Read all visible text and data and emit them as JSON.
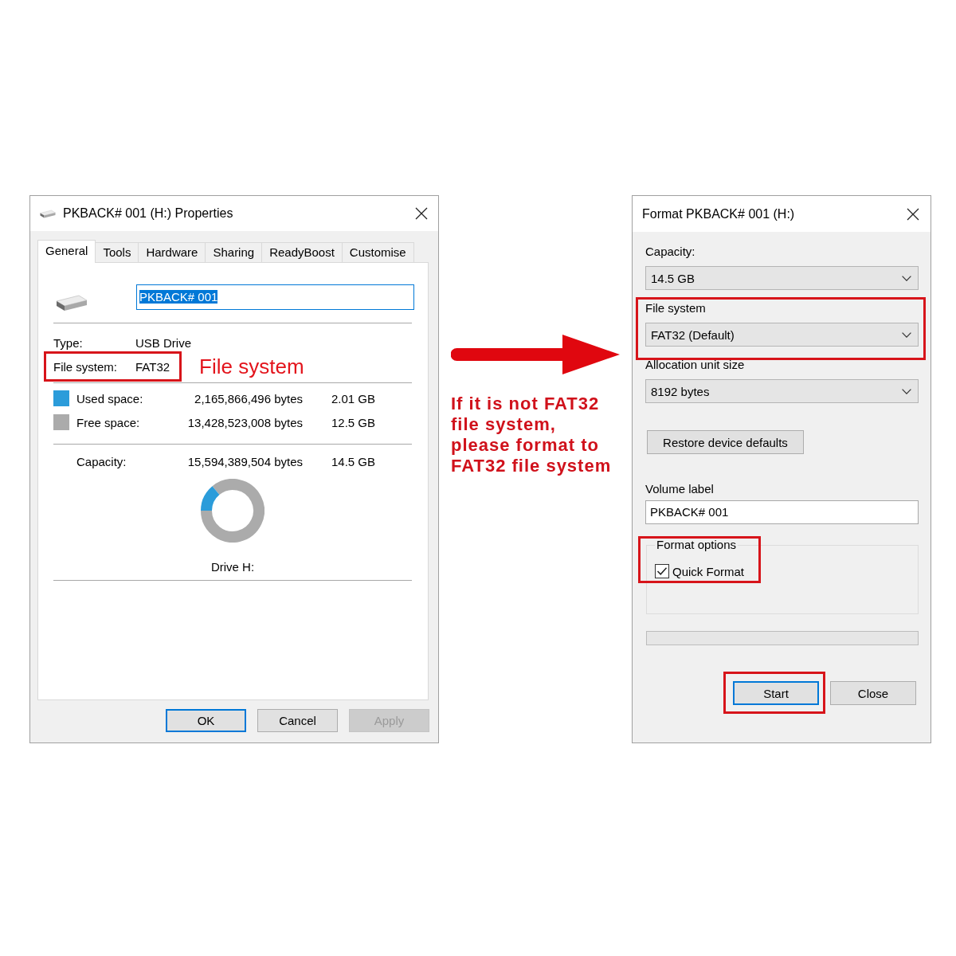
{
  "properties": {
    "title": "PKBACK# 001 (H:) Properties",
    "tabs": [
      {
        "label": "General",
        "selected": true
      },
      {
        "label": "Tools",
        "selected": false
      },
      {
        "label": "Hardware",
        "selected": false
      },
      {
        "label": "Sharing",
        "selected": false
      },
      {
        "label": "ReadyBoost",
        "selected": false
      },
      {
        "label": "Customise",
        "selected": false
      }
    ],
    "name_field": {
      "value": "PKBACK# 001",
      "text_selected": true
    },
    "info_rows": [
      {
        "label": "Type:",
        "value": "USB Drive",
        "highlighted": false
      },
      {
        "label": "File system:",
        "value": "FAT32",
        "highlighted": true
      }
    ],
    "annotation": "File system",
    "space_rows": [
      {
        "label": "Used space:",
        "bytes": "2,165,866,496 bytes",
        "size": "2.01 GB",
        "color": "#2b9cda"
      },
      {
        "label": "Free space:",
        "bytes": "13,428,523,008 bytes",
        "size": "12.5 GB",
        "color": "#ababab"
      }
    ],
    "capacity": {
      "label": "Capacity:",
      "bytes": "15,594,389,504 bytes",
      "size": "14.5 GB"
    },
    "usage_ring": {
      "level": 0.14
    },
    "drive_label": "Drive H:",
    "buttons": [
      {
        "label": "OK",
        "default": true,
        "disabled": false
      },
      {
        "label": "Cancel",
        "default": false,
        "disabled": false
      },
      {
        "label": "Apply",
        "default": false,
        "disabled": true
      }
    ]
  },
  "instruction": "If it is not FAT32 file system, please format to FAT32 file system",
  "format": {
    "title": "Format PKBACK# 001 (H:)",
    "fields": [
      {
        "label": "Capacity:",
        "value": "14.5 GB",
        "highlighted": false
      },
      {
        "label": "File system",
        "value": "FAT32 (Default)",
        "highlighted": true
      },
      {
        "label": "Allocation unit size",
        "value": "8192 bytes",
        "highlighted": false
      }
    ],
    "restore_button": "Restore device defaults",
    "volume_label": {
      "label": "Volume label",
      "value": "PKBACK# 001"
    },
    "format_options": {
      "title": "Format options",
      "highlighted": true,
      "options": [
        {
          "label": "Quick Format",
          "checked": true
        }
      ]
    },
    "progress": {
      "level": 0
    },
    "buttons": [
      {
        "label": "Start",
        "default": true,
        "highlighted": true
      },
      {
        "label": "Close",
        "default": false,
        "highlighted": false
      }
    ]
  }
}
